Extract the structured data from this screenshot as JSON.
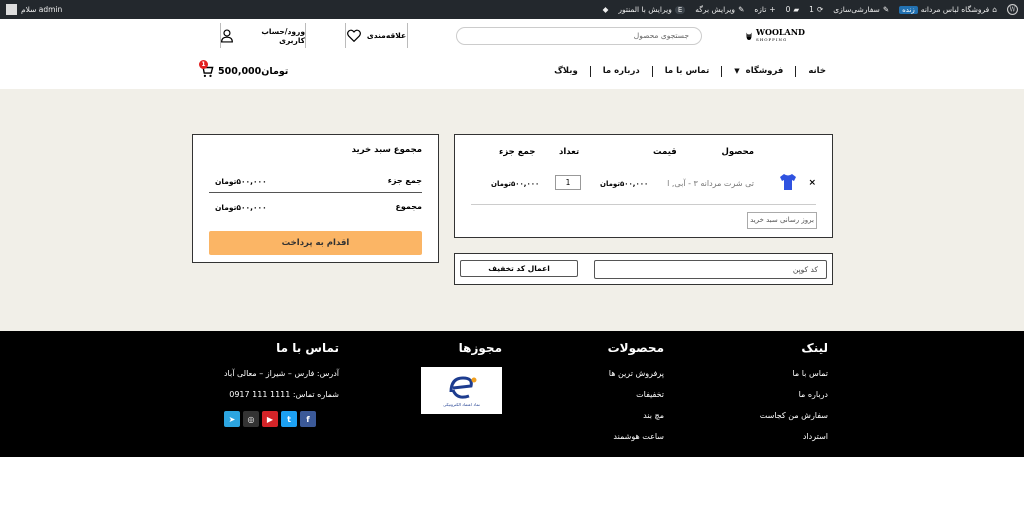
{
  "adminbar": {
    "site_name": "فروشگاه لباس مردانه",
    "live_badge": "زنده",
    "customize": "سفارشی‌سازی",
    "updates_count": "1",
    "comments_count": "0",
    "new": "تازه",
    "edit_page": "ویرایش برگه",
    "elementor": "ویرایش با المنتور",
    "greeting": "سلام admin"
  },
  "header": {
    "logo_title": "WOOLAND",
    "logo_sub": "SHOPPING",
    "search_placeholder": "جستجوی محصول",
    "wishlist_label": "علاقه‌مندی",
    "account_label": "ورود/حساب کاربری",
    "cart_total": "500,000تومان",
    "cart_count": "1"
  },
  "nav": {
    "items": [
      "خانه",
      "فروشگاه",
      "تماس با ما",
      "درباره ما",
      "وبلاگ"
    ]
  },
  "cart_table": {
    "headers": {
      "product": "محصول",
      "price": "قیمت",
      "quantity": "تعداد",
      "subtotal": "جمع جزء"
    },
    "item": {
      "name": "تی شرت مردانه ۳ - آبی, l",
      "price": "۵۰۰,۰۰۰تومان",
      "qty": "1",
      "subtotal": "۵۰۰,۰۰۰تومان",
      "remove": "×"
    },
    "update_label": "بروز رسانی سبد خرید"
  },
  "coupon": {
    "placeholder": "کد کوپن",
    "apply_label": "اعمال کد تخفیف"
  },
  "totals": {
    "title": "مجموع سبد خرید",
    "subtotal_label": "جمع جزء",
    "subtotal_value": "۵۰۰,۰۰۰تومان",
    "total_label": "مجموع",
    "total_value": "۵۰۰,۰۰۰تومان",
    "checkout_label": "اقدام به پرداخت"
  },
  "footer": {
    "links": {
      "title": "لینک",
      "items": [
        "تماس با ما",
        "درباره ما",
        "سفارش من کجاست",
        "استرداد"
      ]
    },
    "products": {
      "title": "محصولات",
      "items": [
        "پرفروش ترین ها",
        "تخفیفات",
        "مچ بند",
        "ساعت هوشمند"
      ]
    },
    "licenses": {
      "title": "مجوزها",
      "badge_text": "نماد اعتماد الکترونیکی"
    },
    "contact": {
      "title": "تماس با ما",
      "address": "آدرس: فارس – شیراز – معالی آباد",
      "phone": "شماره تماس: 1111 111 0917"
    },
    "social_colors": {
      "telegram": "#2ca5e0",
      "instagram": "#333333",
      "youtube": "#d42428",
      "twitter": "#1da1f2",
      "facebook": "#3b5998"
    }
  }
}
